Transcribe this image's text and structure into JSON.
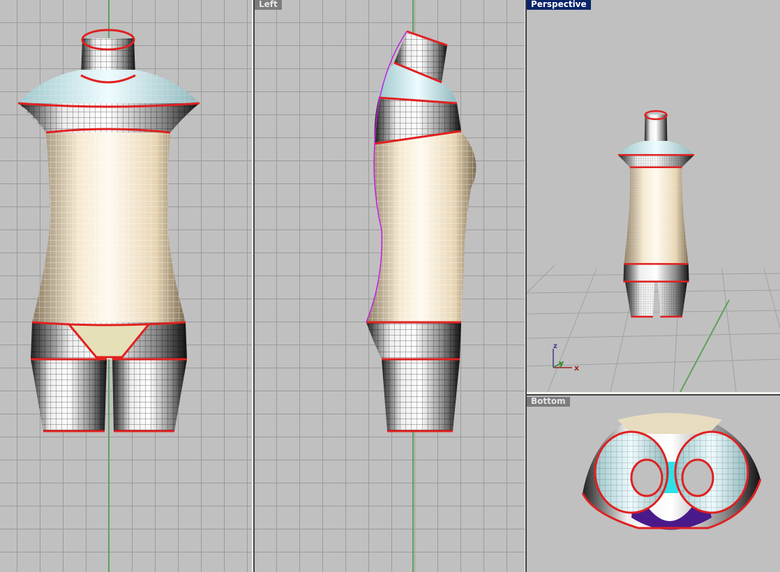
{
  "viewports": {
    "front": {
      "label": ""
    },
    "left": {
      "label": "Left"
    },
    "perspective": {
      "label": "Perspective",
      "active": true
    },
    "bottom": {
      "label": "Bottom"
    }
  },
  "axes": {
    "x": "x",
    "y": "y",
    "z": "z"
  },
  "colors": {
    "grid_bg": "#c0c0c0",
    "grid_line": "#9a9a9a",
    "active_label": "#0a246a",
    "section_curve": "#e02020",
    "y_axis": "#5fa05f"
  }
}
